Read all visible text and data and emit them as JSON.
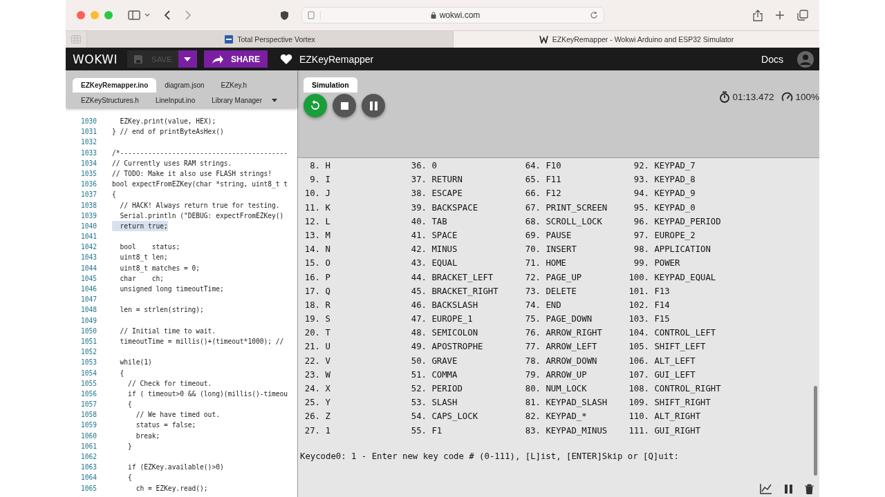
{
  "browser": {
    "url": "wokwi.com",
    "tabs": [
      {
        "title": "Total Perspective Vortex",
        "selected": false
      },
      {
        "title": "EZKeyRemapper - Wokwi Arduino and ESP32 Simulator",
        "selected": true
      }
    ]
  },
  "header": {
    "logo": "WOKWI",
    "save": {
      "label": "SAVE",
      "disabled": true
    },
    "share": "SHARE",
    "project": "EZKeyRemapper",
    "docs": "Docs"
  },
  "editor": {
    "tab_rows": [
      [
        {
          "label": "EZKeyRemapper.ino",
          "selected": true
        },
        {
          "label": "diagram.json",
          "selected": false
        },
        {
          "label": "EZKey.h",
          "selected": false
        }
      ],
      [
        {
          "label": "EZKeyStructures.h",
          "selected": false
        },
        {
          "label": "LineInput.ino",
          "selected": false
        },
        {
          "label": "Library Manager",
          "selected": false
        }
      ]
    ],
    "lines": [
      {
        "n": "1030",
        "text": "  EZKey.print(value, HEX);"
      },
      {
        "n": "1031",
        "text": "} // end of printByteAsHex()"
      },
      {
        "n": "1032"
      },
      {
        "n": "1033",
        "text": "/*------------------------------------------"
      },
      {
        "n": "1034",
        "text": "// Currently uses RAM strings."
      },
      {
        "n": "1035",
        "text": "// TODO: Make it also use FLASH strings!"
      },
      {
        "n": "1036",
        "text": "bool expectFromEZKey(char *string, uint8_t t"
      },
      {
        "n": "1037",
        "text": "{"
      },
      {
        "n": "1038",
        "text": "  // HACK! Always return true for testing."
      },
      {
        "n": "1039",
        "text": "  Serial.println (\"DEBUG: expectFromEZKey()"
      },
      {
        "n": "1040",
        "text": "  return true;",
        "highlighted": true
      },
      {
        "n": "1041"
      },
      {
        "n": "1042",
        "text": "  bool    status;"
      },
      {
        "n": "1043",
        "text": "  uint8_t len;"
      },
      {
        "n": "1044",
        "text": "  uint8_t matches = 0;"
      },
      {
        "n": "1045",
        "text": "  char    ch;"
      },
      {
        "n": "1046",
        "text": "  unsigned long timeoutTime;"
      },
      {
        "n": "1047"
      },
      {
        "n": "1048",
        "text": "  len = strlen(string);"
      },
      {
        "n": "1049"
      },
      {
        "n": "1050",
        "text": "  // Initial time to wait."
      },
      {
        "n": "1051",
        "text": "  timeoutTime = millis()+(timeout*1000); //"
      },
      {
        "n": "1052"
      },
      {
        "n": "1053",
        "text": "  while(1)"
      },
      {
        "n": "1054",
        "text": "  {"
      },
      {
        "n": "1055",
        "text": "    // Check for timeout."
      },
      {
        "n": "1056",
        "text": "    if ( timeout>0 && (long)(millis()-timeou"
      },
      {
        "n": "1057",
        "text": "    {"
      },
      {
        "n": "1058",
        "text": "      // We have timed out."
      },
      {
        "n": "1059",
        "text": "      status = false;"
      },
      {
        "n": "1060",
        "text": "      break;"
      },
      {
        "n": "1061",
        "text": "    }"
      },
      {
        "n": "1062"
      },
      {
        "n": "1063",
        "text": "    if (EZKey.available()>0)"
      },
      {
        "n": "1064",
        "text": "    {"
      },
      {
        "n": "1065",
        "text": "      ch = EZKey.read();"
      }
    ]
  },
  "simulation": {
    "tab": {
      "label": "Simulation",
      "selected": true
    },
    "timer": "01:13.472",
    "speed": "100%"
  },
  "serial_monitor": {
    "rows": [
      [
        "8. H",
        "36. 0",
        "64. F10",
        "92. KEYPAD_7"
      ],
      [
        "9. I",
        "37. RETURN",
        "65. F11",
        "93. KEYPAD_8"
      ],
      [
        "10. J",
        "38. ESCAPE",
        "66. F12",
        "94. KEYPAD_9"
      ],
      [
        "11. K",
        "39. BACKSPACE",
        "67. PRINT_SCREEN",
        "95. KEYPAD_0"
      ],
      [
        "12. L",
        "40. TAB",
        "68. SCROLL_LOCK",
        "96. KEYPAD_PERIOD"
      ],
      [
        "13. M",
        "41. SPACE",
        "69. PAUSE",
        "97. EUROPE_2"
      ],
      [
        "14. N",
        "42. MINUS",
        "70. INSERT",
        "98. APPLICATION"
      ],
      [
        "15. O",
        "43. EQUAL",
        "71. HOME",
        "99. POWER"
      ],
      [
        "16. P",
        "44. BRACKET_LEFT",
        "72. PAGE_UP",
        "100. KEYPAD_EQUAL"
      ],
      [
        "17. Q",
        "45. BRACKET_RIGHT",
        "73. DELETE",
        "101. F13"
      ],
      [
        "18. R",
        "46. BACKSLASH",
        "74. END",
        "102. F14"
      ],
      [
        "19. S",
        "47. EUROPE_1",
        "75. PAGE_DOWN",
        "103. F15"
      ],
      [
        "20. T",
        "48. SEMICOLON",
        "76. ARROW_RIGHT",
        "104. CONTROL_LEFT"
      ],
      [
        "21. U",
        "49. APOSTROPHE",
        "77. ARROW_LEFT",
        "105. SHIFT_LEFT"
      ],
      [
        "22. V",
        "50. GRAVE",
        "78. ARROW_DOWN",
        "106. ALT_LEFT"
      ],
      [
        "23. W",
        "51. COMMA",
        "79. ARROW_UP",
        "107. GUI_LEFT"
      ],
      [
        "24. X",
        "52. PERIOD",
        "80. NUM_LOCK",
        "108. CONTROL_RIGHT"
      ],
      [
        "25. Y",
        "53. SLASH",
        "81. KEYPAD_SLASH",
        "109. SHIFT_RIGHT"
      ],
      [
        "26. Z",
        "54. CAPS_LOCK",
        "82. KEYPAD_*",
        "110. ALT_RIGHT"
      ],
      [
        "27. 1",
        "55. F1",
        "83. KEYPAD_MINUS",
        "111. GUI_RIGHT"
      ]
    ],
    "prompt": "Keycode0: 1 - Enter new key code # (0-111), [L]ist, [ENTER]Skip or [Q]uit:"
  }
}
